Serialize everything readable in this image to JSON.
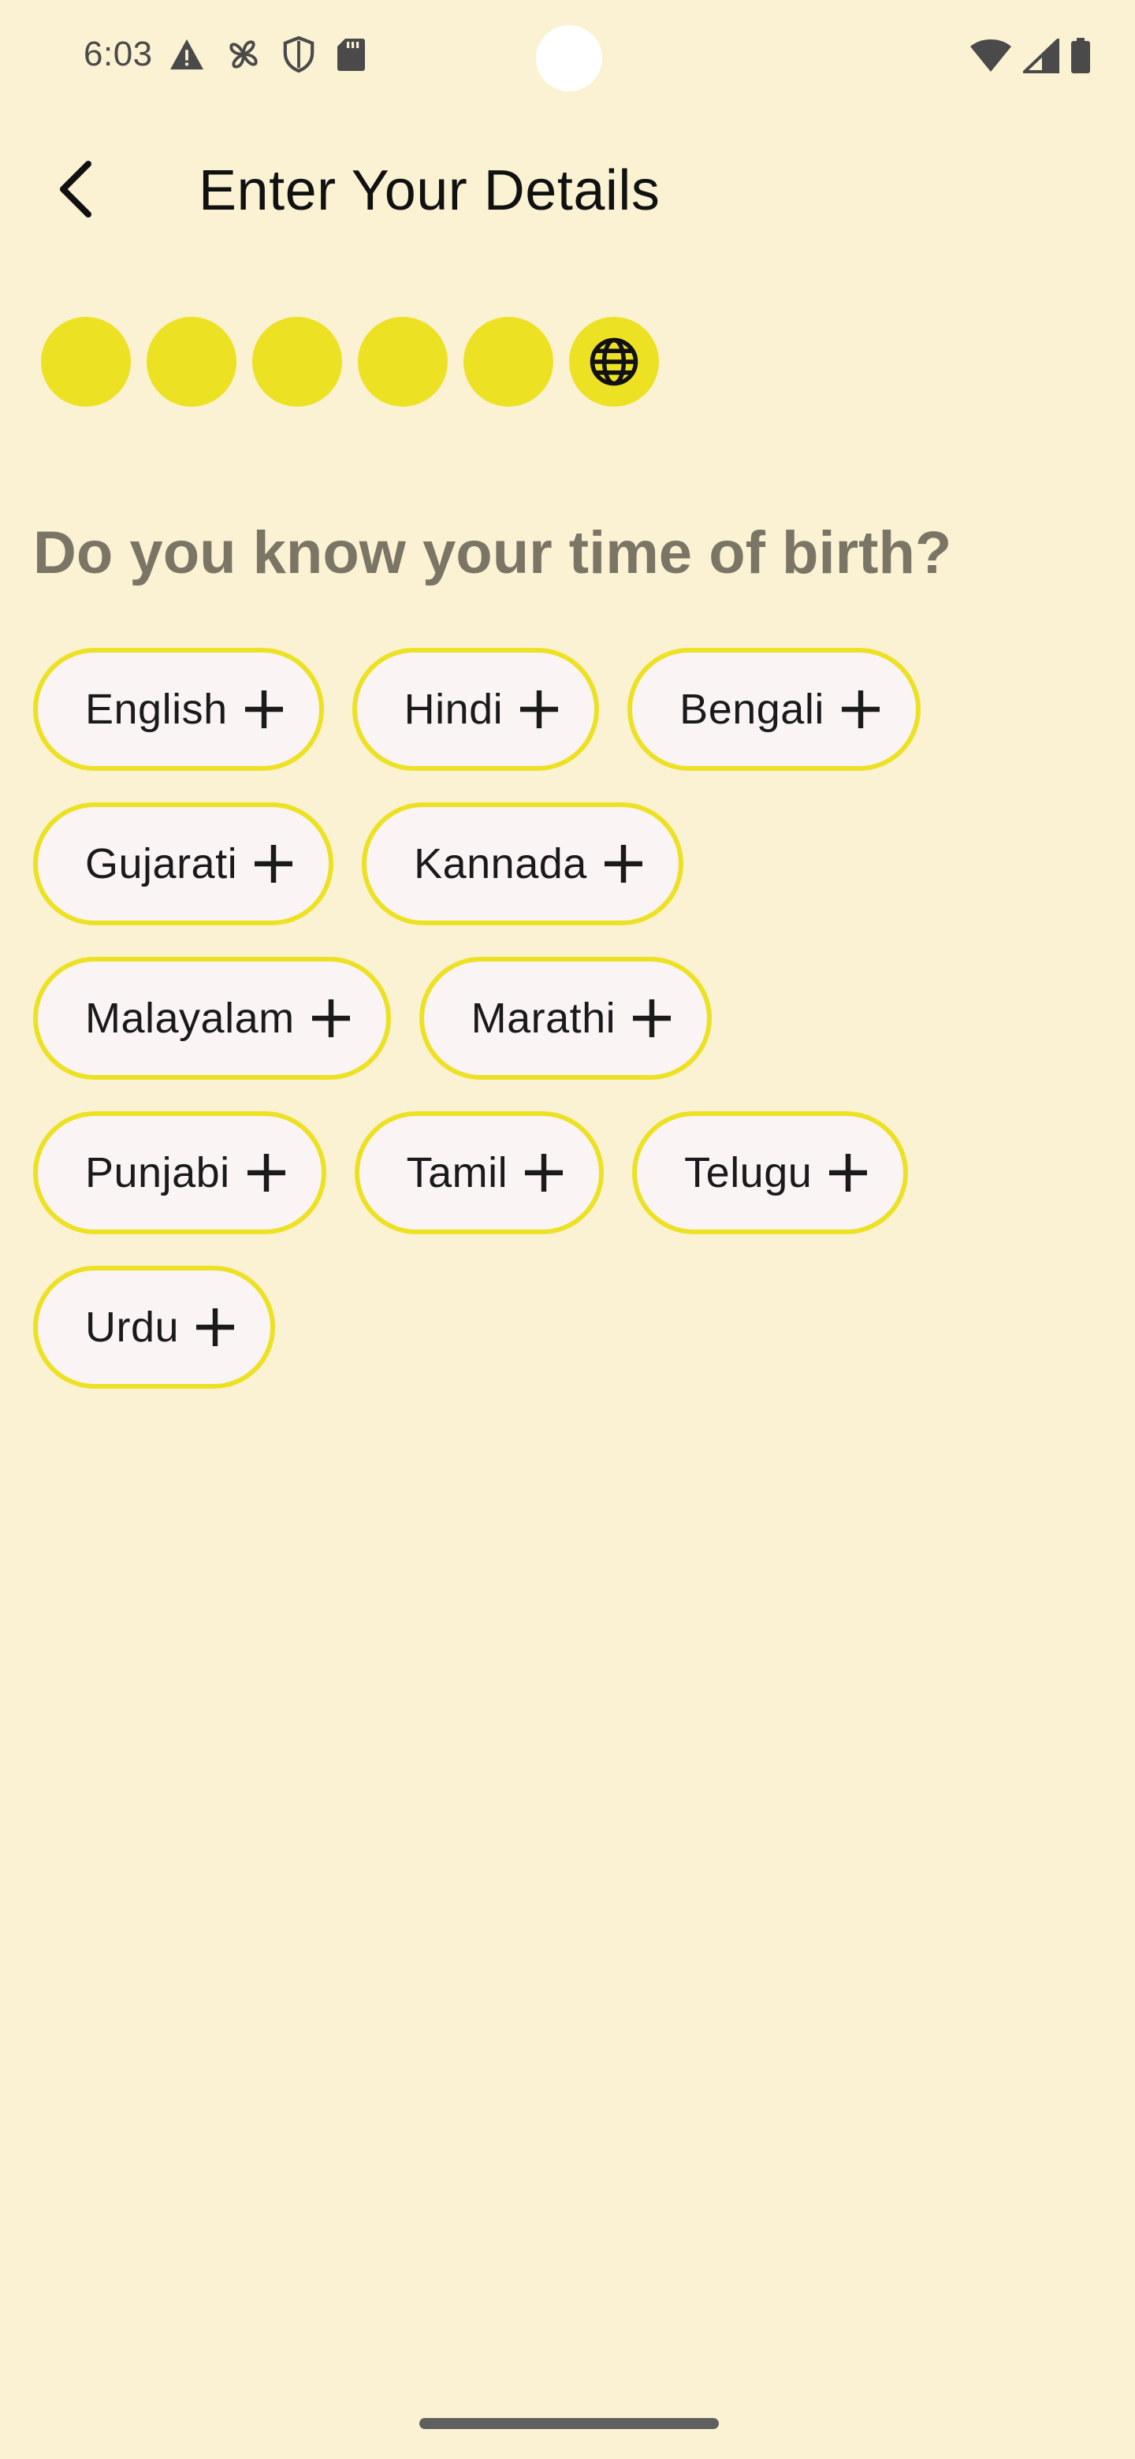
{
  "status_bar": {
    "time": "6:03",
    "left_icons": [
      "warning-icon",
      "fan-icon",
      "shield-icon",
      "sd-card-icon"
    ],
    "right_icons": [
      "wifi-icon",
      "signal-icon",
      "battery-icon"
    ]
  },
  "header": {
    "title": "Enter Your Details",
    "back_icon": "chevron-left-icon"
  },
  "steps": {
    "total": 6,
    "current_icon": "globe-icon",
    "accent_color": "#ede124"
  },
  "question": "Do you know your time of birth?",
  "chips": {
    "rows": [
      [
        {
          "label": "English"
        },
        {
          "label": "Hindi"
        },
        {
          "label": "Bengali"
        }
      ],
      [
        {
          "label": "Gujarati"
        },
        {
          "label": "Kannada"
        }
      ],
      [
        {
          "label": "Malayalam"
        },
        {
          "label": "Marathi"
        }
      ],
      [
        {
          "label": "Punjabi"
        },
        {
          "label": "Tamil"
        },
        {
          "label": "Telugu"
        }
      ],
      [
        {
          "label": "Urdu"
        }
      ]
    ],
    "action_icon": "plus-icon"
  },
  "colors": {
    "background": "#fbf2d3",
    "chip_border": "#ede124",
    "chip_fill": "#fbf4f5",
    "question_text": "#7a7565"
  }
}
